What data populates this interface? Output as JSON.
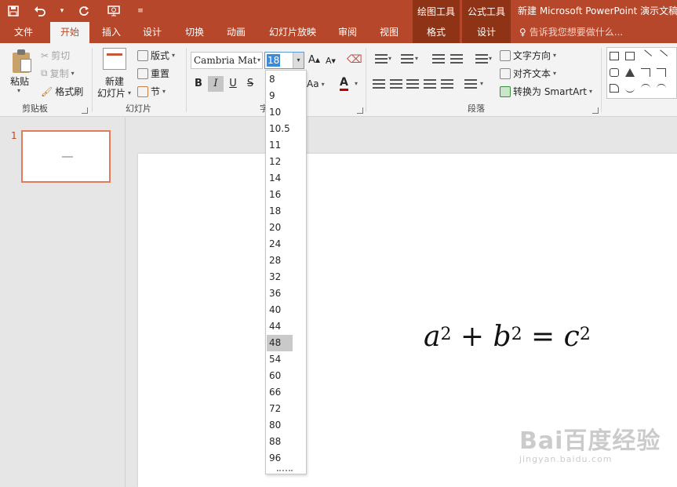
{
  "title_bar": {
    "context_draw": "绘图工具",
    "context_formula": "公式工具",
    "document_title": "新建 Microsoft PowerPoint 演示文稿"
  },
  "tabs": [
    {
      "label": "文件"
    },
    {
      "label": "开始"
    },
    {
      "label": "插入"
    },
    {
      "label": "设计"
    },
    {
      "label": "切换"
    },
    {
      "label": "动画"
    },
    {
      "label": "幻灯片放映"
    },
    {
      "label": "审阅"
    },
    {
      "label": "视图"
    },
    {
      "label": "格式"
    },
    {
      "label": "设计"
    }
  ],
  "tell_me": "告诉我您想要做什么...",
  "clipboard": {
    "paste": "粘贴",
    "cut": "剪切",
    "copy": "复制",
    "format_painter": "格式刷",
    "group": "剪贴板"
  },
  "slides_group": {
    "new_slide": "新建",
    "new_slide_line2": "幻灯片",
    "layout": "版式",
    "reset": "重置",
    "section": "节",
    "group": "幻灯片"
  },
  "font": {
    "name": "Cambria Mat",
    "size": "18",
    "bold": "B",
    "italic": "I",
    "underline": "U",
    "strike": "S",
    "grow": "A",
    "shrink": "A",
    "case": "Aa",
    "color": "A",
    "group_partial": "字"
  },
  "paragraph": {
    "text_direction": "文字方向",
    "align_text": "对齐文本",
    "smartart": "转换为 SmartArt",
    "group": "段落"
  },
  "size_list": {
    "items": [
      "8",
      "9",
      "10",
      "10.5",
      "11",
      "12",
      "14",
      "16",
      "18",
      "20",
      "24",
      "28",
      "32",
      "36",
      "40",
      "44",
      "48",
      "54",
      "60",
      "66",
      "72",
      "80",
      "88",
      "96"
    ],
    "highlighted": "48"
  },
  "thumbnail": {
    "number": "1"
  },
  "equation": {
    "a": "a",
    "b": "b",
    "c": "c",
    "exp": "2",
    "plus": "+",
    "equals": "="
  },
  "watermark": {
    "main": "Bai百度经验",
    "sub": "jingyan.baidu.com"
  }
}
